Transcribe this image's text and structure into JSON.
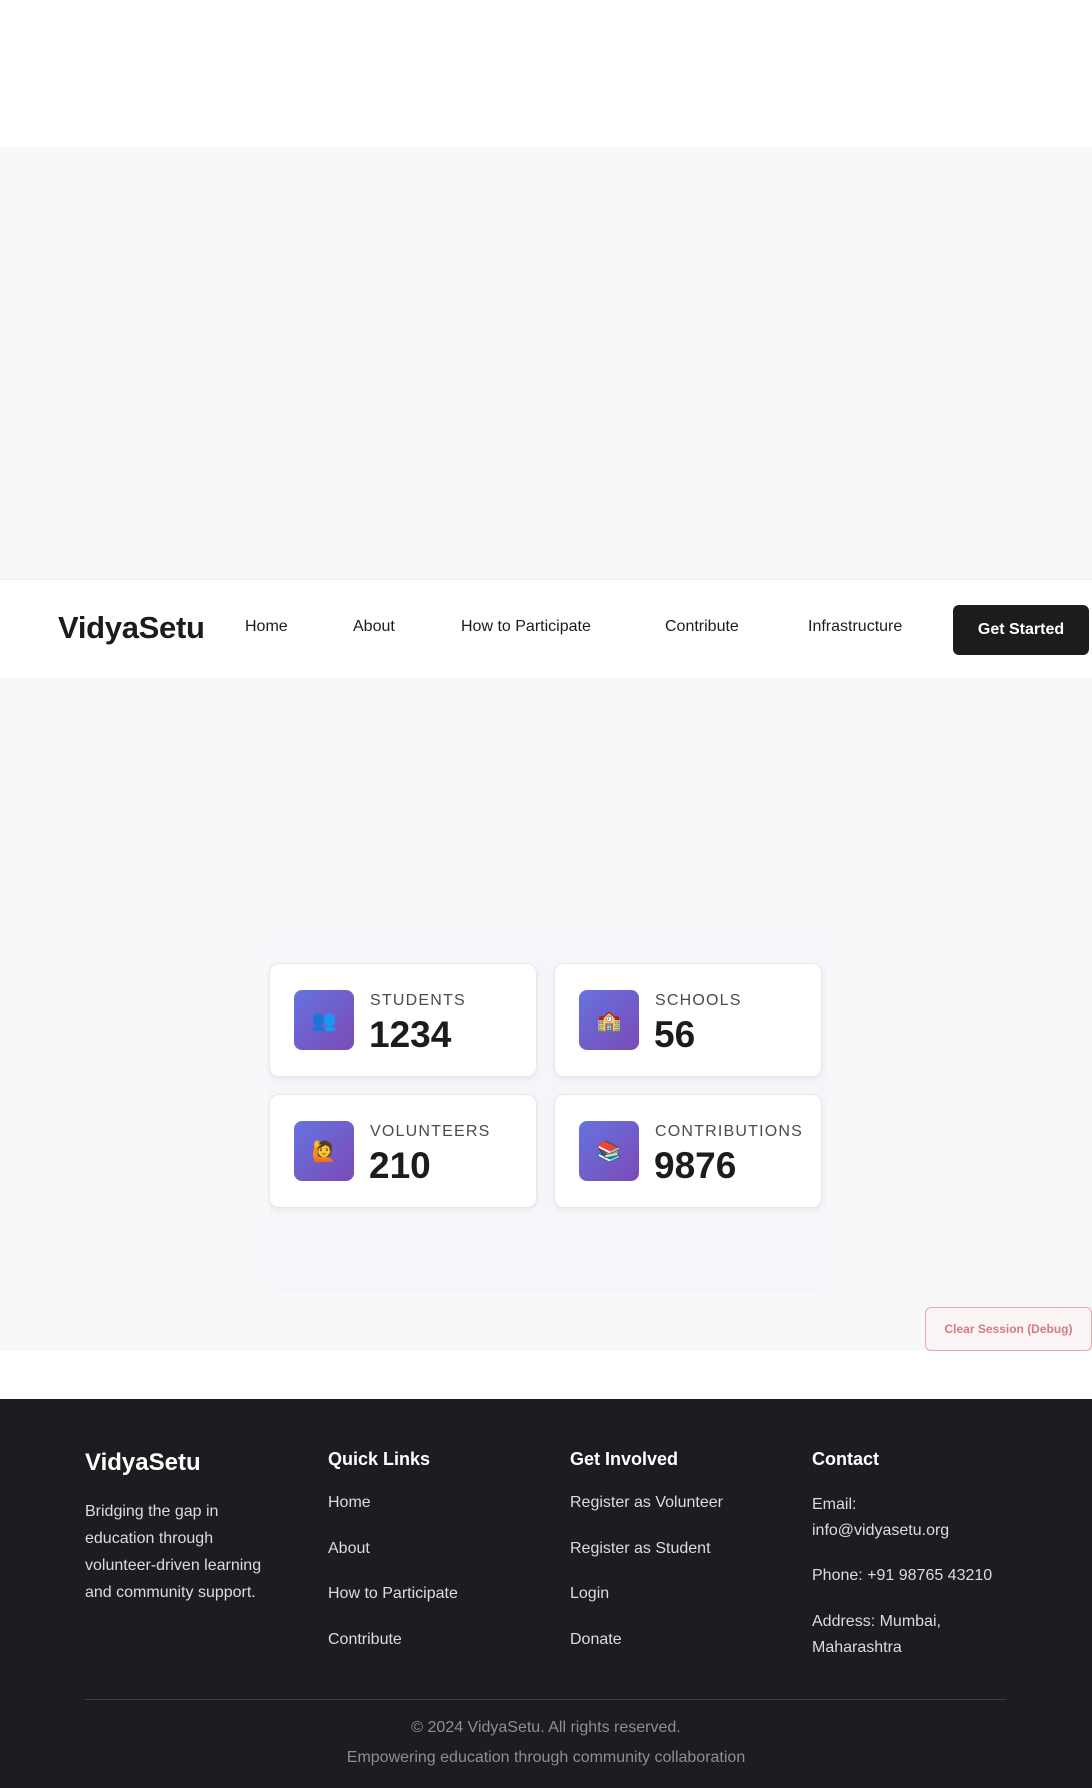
{
  "navbar": {
    "brand": "VidyaSetu",
    "links": [
      "Home",
      "About",
      "How to Participate",
      "Contribute",
      "Infrastructure"
    ],
    "cta": "Get Started"
  },
  "stats": [
    {
      "label": "STUDENTS",
      "value": "1234",
      "icon": "students-icon",
      "glyph": "👥"
    },
    {
      "label": "SCHOOLS",
      "value": "56",
      "icon": "school-icon",
      "glyph": "🏫"
    },
    {
      "label": "VOLUNTEERS",
      "value": "210",
      "icon": "volunteer-icon",
      "glyph": "🙋"
    },
    {
      "label": "CONTRIBUTIONS",
      "value": "9876",
      "icon": "books-icon",
      "glyph": "📚"
    }
  ],
  "debug_button": "Clear Session (Debug)",
  "footer": {
    "brand": "VidyaSetu",
    "tagline": "Bridging the gap in education through volunteer-driven learning and community support.",
    "quick_links": {
      "heading": "Quick Links",
      "items": [
        "Home",
        "About",
        "How to Participate",
        "Contribute"
      ]
    },
    "get_involved": {
      "heading": "Get Involved",
      "items": [
        "Register as Volunteer",
        "Register as Student",
        "Login",
        "Donate"
      ]
    },
    "contact": {
      "heading": "Contact",
      "email": "Email: info@vidyasetu.org",
      "phone": "Phone: +91 98765 43210",
      "address": "Address: Mumbai, Maharashtra"
    },
    "copyright": "© 2024 VidyaSetu. All rights reserved.",
    "motto": "Empowering education through community collaboration"
  },
  "colors": {
    "accent_gradient_start": "#6673e0",
    "accent_gradient_end": "#7b4ab6",
    "cta_bg": "#1c1c1e",
    "footer_bg": "#1c1d20",
    "debug_text": "#d27c86"
  }
}
